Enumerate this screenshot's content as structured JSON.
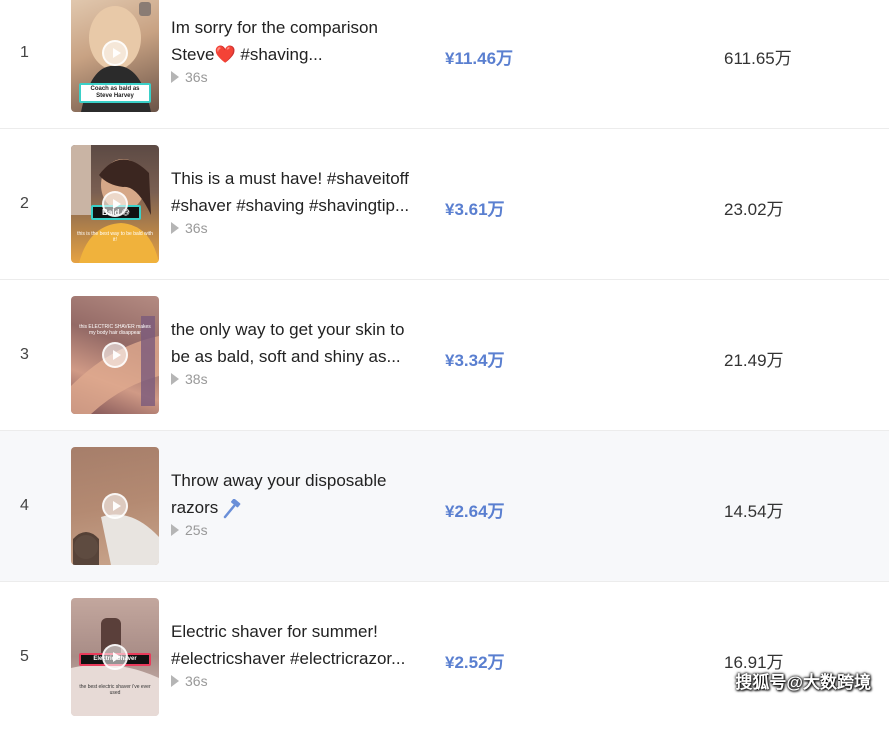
{
  "rows": [
    {
      "rank": "1",
      "title_line1": "Im sorry for the comparison",
      "title_line2": "Steve",
      "title_line2_emoji": "❤️",
      "title_line2_tail": " #shaving...",
      "duration": "36s",
      "price": "¥11.46万",
      "plays": "611.65万",
      "thumb_caption": "Coach as bald as Steve Harvey"
    },
    {
      "rank": "2",
      "title_line1": "This is a must have! #shaveitoff",
      "title_line2": "#shaver #shaving #shavingtip...",
      "duration": "36s",
      "price": "¥3.61万",
      "plays": "23.02万",
      "thumb_caption": "Bald 😅",
      "thumb_subcaption": "this is the best way to be bald with it!"
    },
    {
      "rank": "3",
      "title_line1": "the only way to get your skin to",
      "title_line2": "be as bald, soft and shiny as...",
      "duration": "38s",
      "price": "¥3.34万",
      "plays": "21.49万",
      "thumb_subcaption": "this ELECTRIC SHAVER makes my body hair disappear"
    },
    {
      "rank": "4",
      "title_line1": "Throw away your disposable",
      "title_line2": "razors",
      "duration": "25s",
      "price": "¥2.64万",
      "plays": "14.54万",
      "highlighted": true
    },
    {
      "rank": "5",
      "title_line1": "Electric shaver for summer!",
      "title_line2": "#electricshaver #electricrazor...",
      "duration": "36s",
      "price": "¥2.52万",
      "plays": "16.91万",
      "thumb_caption": "Electric Shaver",
      "thumb_subcaption": "the best electric shaver i've ever used"
    }
  ],
  "icons": {
    "play": "play-icon",
    "heart": "heart-icon",
    "razor": "razor-icon"
  },
  "colors": {
    "price": "#5a7fd0",
    "heart": "#e0182d",
    "row_highlight": "#f7f8fa"
  },
  "watermark": "搜狐号@大数跨境"
}
